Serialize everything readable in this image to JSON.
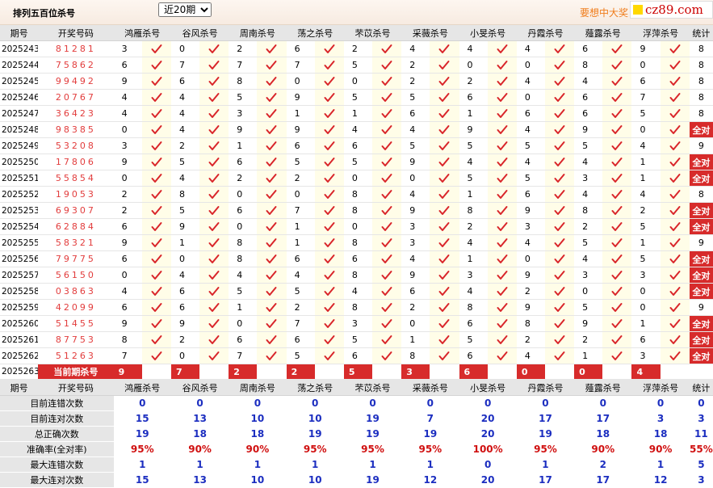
{
  "header": {
    "title": "排列五百位杀号",
    "period_select": "近20期",
    "slogan": "要想中大奖",
    "logo": "cz89.com"
  },
  "columns": {
    "period": "期号",
    "winning": "开奖号码",
    "killers": [
      "鸿雁杀号",
      "谷风杀号",
      "周南杀号",
      "荡之杀号",
      "芣苡杀号",
      "采薇杀号",
      "小旻杀号",
      "丹霞杀号",
      "薤露杀号",
      "浮萍杀号"
    ],
    "total": "统计"
  },
  "rows": [
    {
      "period": "2025243",
      "winning": "81281",
      "kills": [
        3,
        0,
        2,
        6,
        2,
        4,
        4,
        4,
        6,
        9
      ],
      "hits": [
        1,
        1,
        1,
        1,
        1,
        1,
        1,
        1,
        1,
        1
      ],
      "total": "8"
    },
    {
      "period": "2025244",
      "winning": "75862",
      "kills": [
        6,
        7,
        7,
        7,
        5,
        2,
        0,
        0,
        8,
        0
      ],
      "hits": [
        1,
        1,
        1,
        1,
        1,
        1,
        1,
        1,
        1,
        1
      ],
      "total": "8"
    },
    {
      "period": "2025245",
      "winning": "99492",
      "kills": [
        9,
        6,
        8,
        0,
        0,
        2,
        2,
        4,
        4,
        6
      ],
      "hits": [
        1,
        1,
        1,
        1,
        1,
        1,
        1,
        1,
        1,
        1
      ],
      "total": "8"
    },
    {
      "period": "2025246",
      "winning": "20767",
      "kills": [
        4,
        4,
        5,
        9,
        5,
        5,
        6,
        0,
        6,
        7
      ],
      "hits": [
        1,
        1,
        1,
        1,
        1,
        1,
        1,
        1,
        1,
        1
      ],
      "total": "8"
    },
    {
      "period": "2025247",
      "winning": "36423",
      "kills": [
        4,
        4,
        3,
        1,
        1,
        6,
        1,
        6,
        6,
        5
      ],
      "hits": [
        1,
        1,
        1,
        1,
        1,
        1,
        1,
        1,
        1,
        1
      ],
      "total": "8"
    },
    {
      "period": "2025248",
      "winning": "98385",
      "kills": [
        0,
        4,
        9,
        9,
        4,
        4,
        9,
        4,
        9,
        0
      ],
      "hits": [
        1,
        1,
        1,
        1,
        1,
        1,
        1,
        1,
        1,
        1
      ],
      "total": "全对"
    },
    {
      "period": "2025249",
      "winning": "53208",
      "kills": [
        3,
        2,
        1,
        6,
        6,
        5,
        5,
        5,
        5,
        4
      ],
      "hits": [
        1,
        1,
        1,
        1,
        1,
        1,
        1,
        1,
        1,
        1
      ],
      "total": "9"
    },
    {
      "period": "2025250",
      "winning": "17806",
      "kills": [
        9,
        5,
        6,
        5,
        5,
        9,
        4,
        4,
        4,
        1
      ],
      "hits": [
        1,
        1,
        1,
        1,
        1,
        1,
        1,
        1,
        1,
        1
      ],
      "total": "全对"
    },
    {
      "period": "2025251",
      "winning": "55854",
      "kills": [
        0,
        4,
        2,
        2,
        0,
        0,
        5,
        5,
        3,
        1
      ],
      "hits": [
        1,
        1,
        1,
        1,
        1,
        1,
        1,
        1,
        1,
        1
      ],
      "total": "全对"
    },
    {
      "period": "2025252",
      "winning": "19053",
      "kills": [
        2,
        8,
        0,
        0,
        8,
        4,
        1,
        6,
        4,
        4
      ],
      "hits": [
        1,
        1,
        1,
        1,
        1,
        1,
        1,
        1,
        1,
        1
      ],
      "total": "8"
    },
    {
      "period": "2025253",
      "winning": "69307",
      "kills": [
        2,
        5,
        6,
        7,
        8,
        9,
        8,
        9,
        8,
        2
      ],
      "hits": [
        1,
        1,
        1,
        1,
        1,
        1,
        1,
        1,
        1,
        1
      ],
      "total": "全对"
    },
    {
      "period": "2025254",
      "winning": "62884",
      "kills": [
        6,
        9,
        0,
        1,
        0,
        3,
        2,
        3,
        2,
        5
      ],
      "hits": [
        1,
        1,
        1,
        1,
        1,
        1,
        1,
        1,
        1,
        1
      ],
      "total": "全对"
    },
    {
      "period": "2025255",
      "winning": "58321",
      "kills": [
        9,
        1,
        8,
        1,
        8,
        3,
        4,
        4,
        5,
        1
      ],
      "hits": [
        1,
        1,
        1,
        1,
        1,
        1,
        1,
        1,
        1,
        1
      ],
      "total": "9"
    },
    {
      "period": "2025256",
      "winning": "79775",
      "kills": [
        6,
        0,
        8,
        6,
        6,
        4,
        1,
        0,
        4,
        5
      ],
      "hits": [
        1,
        1,
        1,
        1,
        1,
        1,
        1,
        1,
        1,
        1
      ],
      "total": "全对"
    },
    {
      "period": "2025257",
      "winning": "56150",
      "kills": [
        0,
        4,
        4,
        4,
        8,
        9,
        3,
        9,
        3,
        3
      ],
      "hits": [
        1,
        1,
        1,
        1,
        1,
        1,
        1,
        1,
        1,
        1
      ],
      "total": "全对"
    },
    {
      "period": "2025258",
      "winning": "03863",
      "kills": [
        4,
        6,
        5,
        5,
        4,
        6,
        4,
        2,
        0,
        0
      ],
      "hits": [
        1,
        1,
        1,
        1,
        1,
        1,
        1,
        1,
        1,
        1
      ],
      "total": "全对"
    },
    {
      "period": "2025259",
      "winning": "42099",
      "kills": [
        6,
        6,
        1,
        2,
        8,
        2,
        8,
        9,
        5,
        0
      ],
      "hits": [
        1,
        1,
        1,
        1,
        1,
        1,
        1,
        1,
        1,
        1
      ],
      "total": "9"
    },
    {
      "period": "2025260",
      "winning": "51455",
      "kills": [
        9,
        9,
        0,
        7,
        3,
        0,
        6,
        8,
        9,
        1
      ],
      "hits": [
        1,
        1,
        1,
        1,
        1,
        1,
        1,
        1,
        1,
        1
      ],
      "total": "全对"
    },
    {
      "period": "2025261",
      "winning": "87753",
      "kills": [
        8,
        2,
        6,
        6,
        5,
        1,
        5,
        2,
        2,
        6
      ],
      "hits": [
        1,
        1,
        1,
        1,
        1,
        1,
        1,
        1,
        1,
        1
      ],
      "total": "全对"
    },
    {
      "period": "2025262",
      "winning": "51263",
      "kills": [
        7,
        0,
        7,
        5,
        6,
        8,
        6,
        4,
        1,
        3
      ],
      "hits": [
        1,
        1,
        1,
        1,
        1,
        1,
        1,
        1,
        1,
        1
      ],
      "total": "全对"
    }
  ],
  "current": {
    "period": "2025263",
    "label": "当前期杀号",
    "kills": [
      "9",
      "7",
      "2",
      "2",
      "5",
      "3",
      "6",
      "0",
      "0",
      "4"
    ]
  },
  "stats": [
    {
      "label": "目前连错次数",
      "values": [
        "0",
        "0",
        "0",
        "0",
        "0",
        "0",
        "0",
        "0",
        "0",
        "0"
      ],
      "total": "0",
      "color": "blue"
    },
    {
      "label": "目前连对次数",
      "values": [
        "15",
        "13",
        "10",
        "10",
        "19",
        "7",
        "20",
        "17",
        "17",
        "3"
      ],
      "total": "3",
      "color": "blue"
    },
    {
      "label": "总正确次数",
      "values": [
        "19",
        "18",
        "18",
        "19",
        "19",
        "19",
        "20",
        "19",
        "18",
        "18"
      ],
      "total": "11",
      "color": "blue"
    },
    {
      "label": "准确率(全对率)",
      "values": [
        "95%",
        "90%",
        "90%",
        "95%",
        "95%",
        "95%",
        "100%",
        "95%",
        "90%",
        "90%"
      ],
      "total": "55%",
      "color": "red"
    },
    {
      "label": "最大连错次数",
      "values": [
        "1",
        "1",
        "1",
        "1",
        "1",
        "1",
        "0",
        "1",
        "2",
        "1"
      ],
      "total": "5",
      "color": "blue"
    },
    {
      "label": "最大连对次数",
      "values": [
        "15",
        "13",
        "10",
        "10",
        "19",
        "12",
        "20",
        "17",
        "17",
        "12"
      ],
      "total": "3",
      "color": "blue"
    }
  ],
  "colors": {
    "check": "#d9252a",
    "cross": "#9a9a9a",
    "total_all": "#d72b2b",
    "winning": "#e23c3c",
    "header_bg": "#e6e6e6"
  }
}
